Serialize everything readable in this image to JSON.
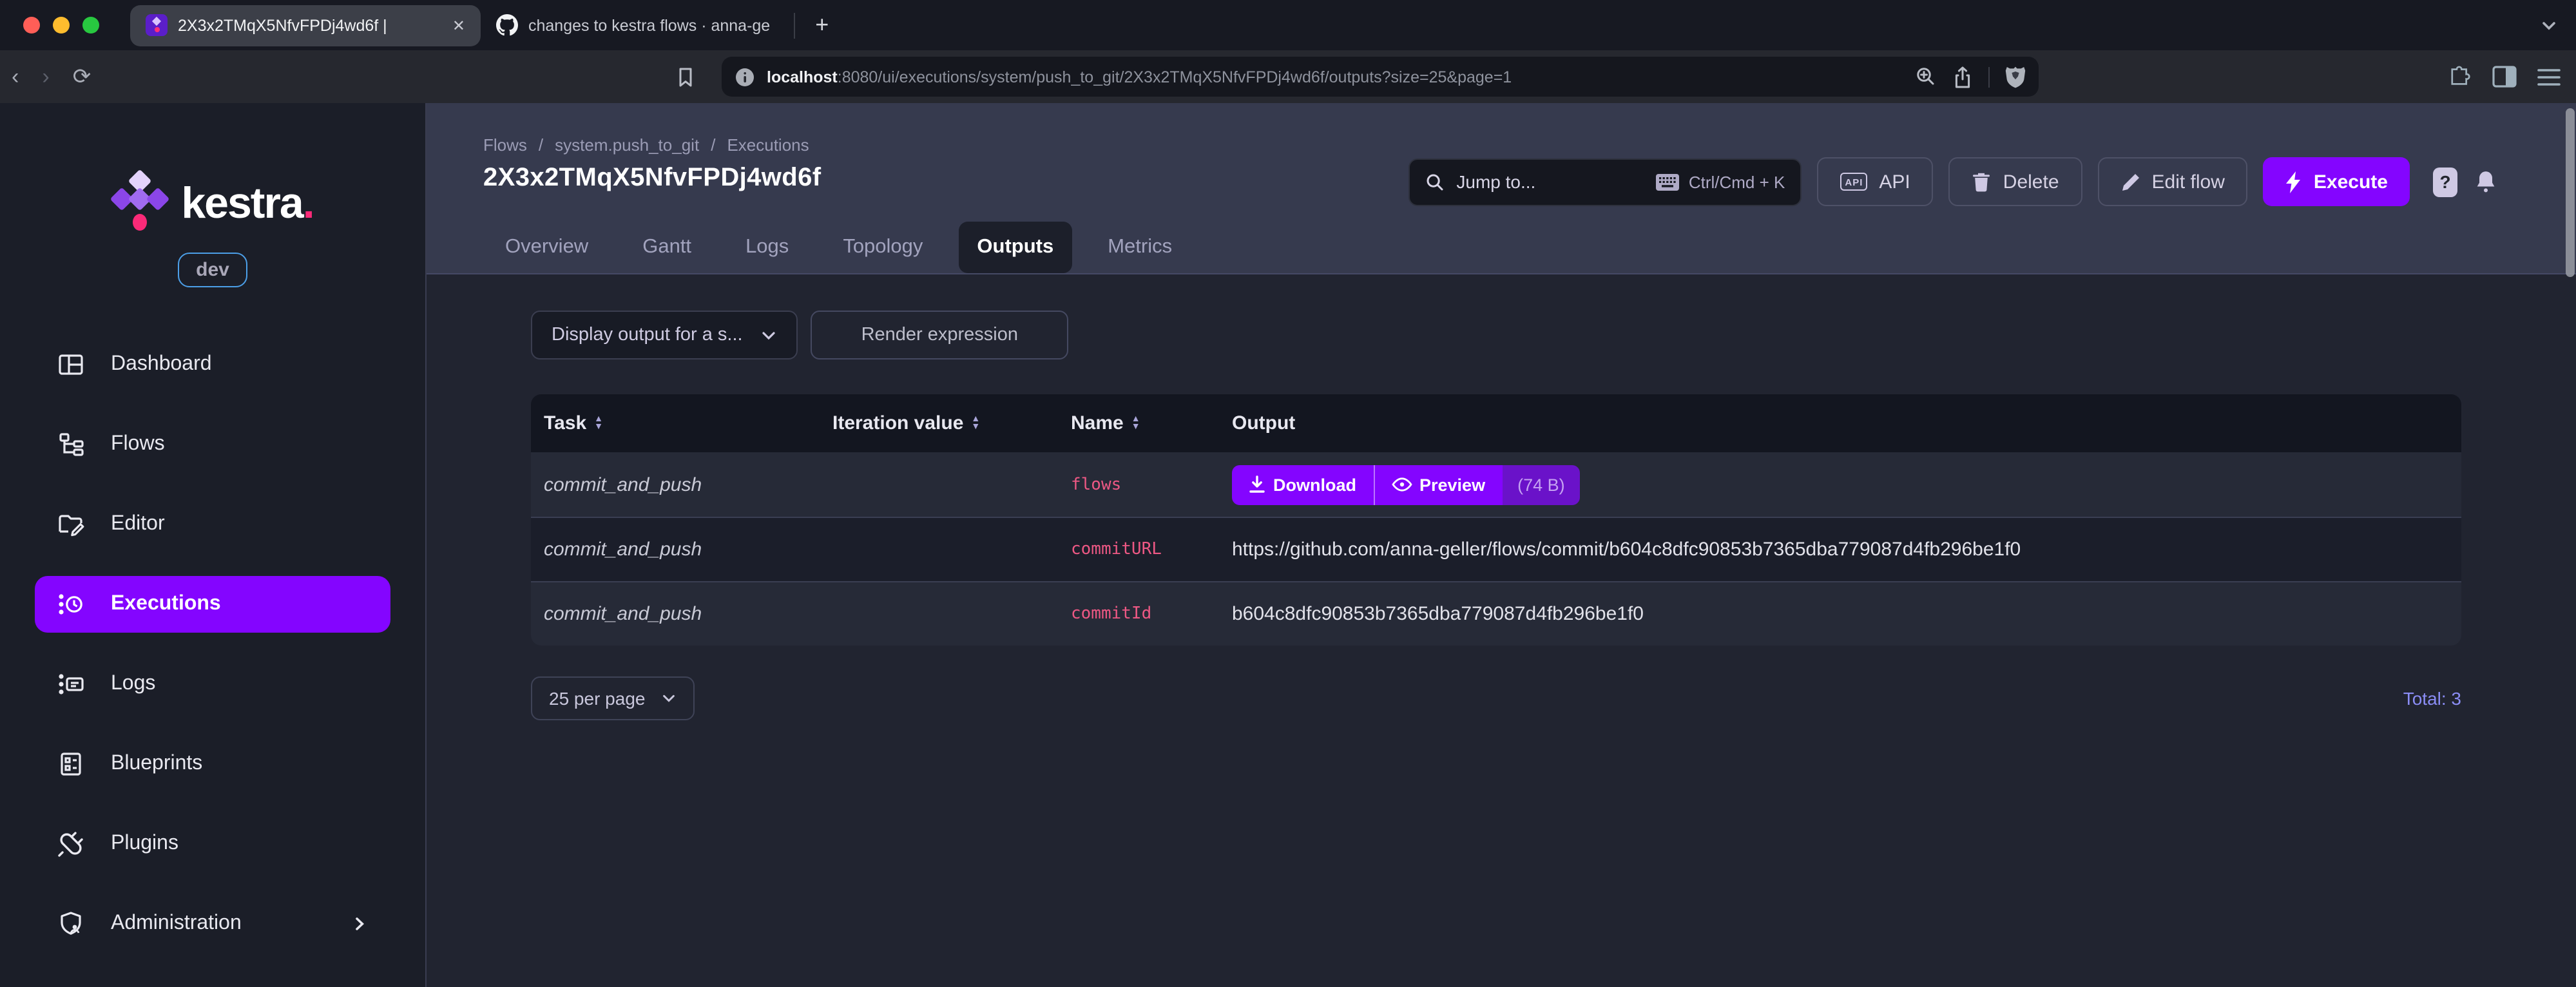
{
  "browser": {
    "tabs": [
      {
        "title": "2X3x2TMqX5NfvFPDj4wd6f |",
        "favicon": "kestra-icon"
      },
      {
        "title": "changes to kestra flows · anna-ge",
        "favicon": "github-icon"
      }
    ],
    "url": {
      "host": "localhost",
      "rest": ":8080/ui/executions/system/push_to_git/2X3x2TMqX5NfvFPDj4wd6f/outputs?size=25&page=1"
    }
  },
  "icons": {
    "close": "✕",
    "plus": "+",
    "back": "‹",
    "forward": "›",
    "reload": "⟳",
    "sort_up": "▲",
    "sort_down": "▼",
    "help": "?"
  },
  "sidebar": {
    "logo_text": "kestra",
    "logo_dot": ".",
    "env_badge": "dev",
    "items": [
      {
        "label": "Dashboard",
        "icon": "dashboard-icon",
        "active": false
      },
      {
        "label": "Flows",
        "icon": "flows-icon",
        "active": false
      },
      {
        "label": "Editor",
        "icon": "editor-icon",
        "active": false
      },
      {
        "label": "Executions",
        "icon": "executions-icon",
        "active": true
      },
      {
        "label": "Logs",
        "icon": "logs-icon",
        "active": false
      },
      {
        "label": "Blueprints",
        "icon": "blueprints-icon",
        "active": false
      },
      {
        "label": "Plugins",
        "icon": "plugins-icon",
        "active": false
      },
      {
        "label": "Administration",
        "icon": "administration-icon",
        "active": false,
        "has_submenu": true
      }
    ]
  },
  "header": {
    "breadcrumb": {
      "items": [
        "Flows",
        "system.push_to_git",
        "Executions"
      ],
      "separator": "/"
    },
    "title": "2X3x2TMqX5NfvFPDj4wd6f",
    "search": {
      "placeholder": "Jump to...",
      "shortcut": "Ctrl/Cmd + K"
    },
    "buttons": {
      "api_chip": "API",
      "api": "API",
      "delete": "Delete",
      "edit_flow": "Edit flow",
      "execute": "Execute"
    }
  },
  "tabs": [
    {
      "label": "Overview",
      "active": false
    },
    {
      "label": "Gantt",
      "active": false
    },
    {
      "label": "Logs",
      "active": false
    },
    {
      "label": "Topology",
      "active": false
    },
    {
      "label": "Outputs",
      "active": true
    },
    {
      "label": "Metrics",
      "active": false
    }
  ],
  "controls": {
    "output_select": "Display output for a s...",
    "render_button": "Render expression"
  },
  "outputs_table": {
    "columns": [
      {
        "label": "Task",
        "sortable": true
      },
      {
        "label": "Iteration value",
        "sortable": true
      },
      {
        "label": "Name",
        "sortable": true
      },
      {
        "label": "Output",
        "sortable": false
      }
    ],
    "rows": [
      {
        "task": "commit_and_push",
        "iteration_value": "",
        "name": "flows",
        "output": {
          "type": "file",
          "download_label": "Download",
          "preview_label": "Preview",
          "size": "(74 B)"
        }
      },
      {
        "task": "commit_and_push",
        "iteration_value": "",
        "name": "commitURL",
        "output": {
          "type": "text",
          "value": "https://github.com/anna-geller/flows/commit/b604c8dfc90853b7365dba779087d4fb296be1f0"
        }
      },
      {
        "task": "commit_and_push",
        "iteration_value": "",
        "name": "commitId",
        "output": {
          "type": "text",
          "value": "b604c8dfc90853b7365dba779087d4fb296be1f0"
        }
      }
    ]
  },
  "pagination": {
    "per_page": "25 per page",
    "total_label": "Total: 3"
  },
  "colors": {
    "brand_purple": "#8405FF",
    "accent_pink": "#ED5884",
    "env_badge_blue": "#4C9FE8",
    "total_purple": "#8B8DF5",
    "size_chip_purple": "#6A12C9",
    "header_strip": "#363A4E",
    "content_bg": "#212430",
    "sidebar_bg": "#1B1E28"
  }
}
